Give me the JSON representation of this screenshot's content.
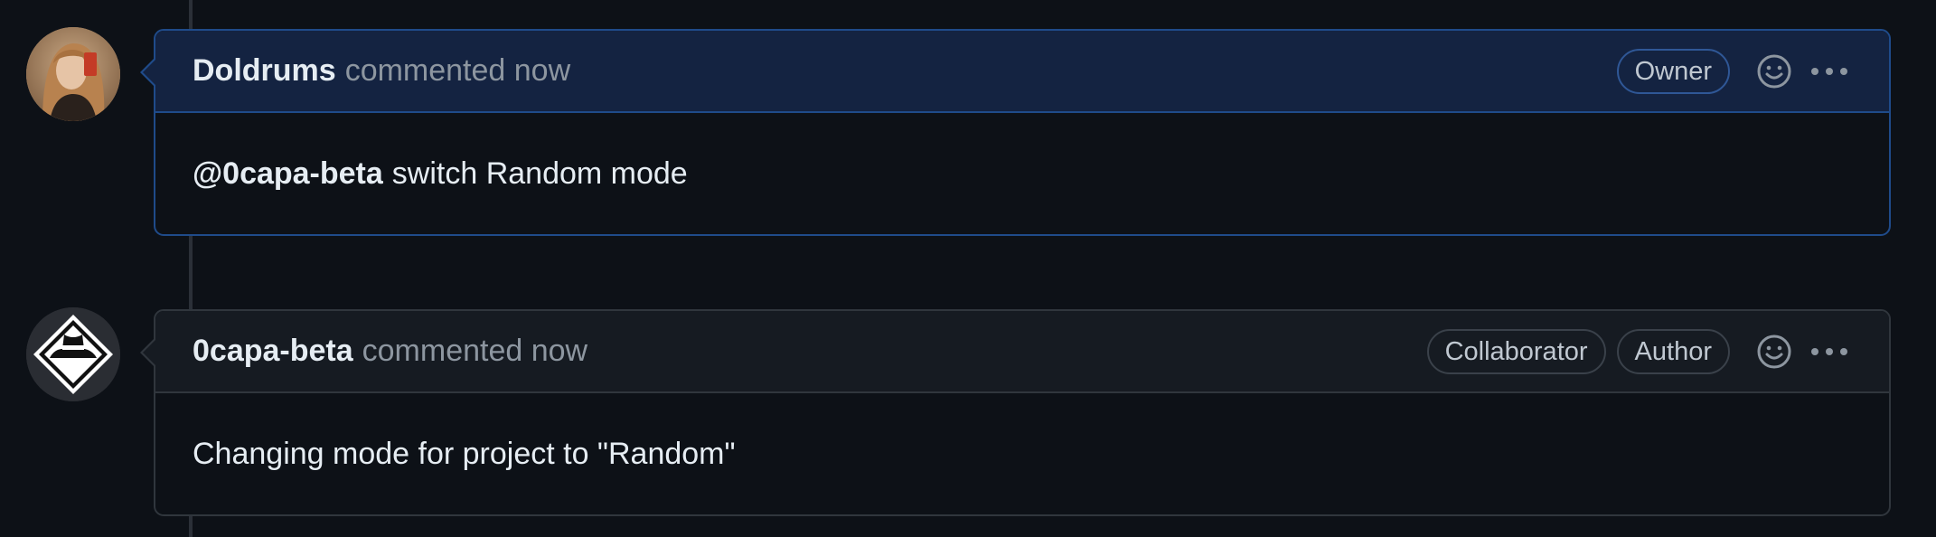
{
  "comments": [
    {
      "author": "Doldrums",
      "action": "commented now",
      "badges": [
        "Owner"
      ],
      "mention": "@0capa-beta",
      "body": "switch Random mode"
    },
    {
      "author": "0capa-beta",
      "action": "commented now",
      "badges": [
        "Collaborator",
        "Author"
      ],
      "body": "Changing mode for project to \"Random\""
    }
  ],
  "colors": {
    "background": "#0d1117",
    "highlight_border": "#1f4b8a",
    "highlight_header": "#142341",
    "border": "#30363d",
    "muted_text": "#8d96a0"
  },
  "icons": [
    "smiley-icon",
    "kebab-horizontal-icon"
  ]
}
